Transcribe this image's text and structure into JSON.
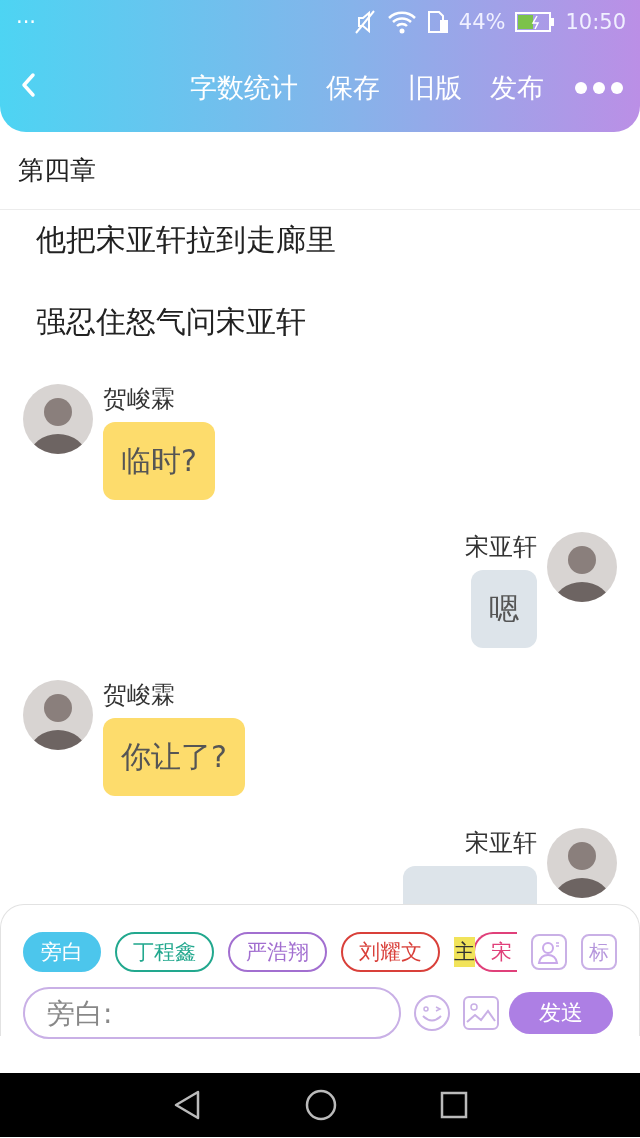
{
  "status_bar": {
    "notification": "···",
    "battery": "44%",
    "time": "10:50"
  },
  "header": {
    "actions": [
      "字数统计",
      "保存",
      "旧版",
      "发布"
    ]
  },
  "chapter_title": "第四章",
  "messages": [
    {
      "kind": "narration",
      "text": "他把宋亚轩拉到走廊里"
    },
    {
      "kind": "narration",
      "text": "强忍住怒气问宋亚轩"
    },
    {
      "kind": "chat",
      "mine": false,
      "speaker": "贺峻霖",
      "text": "临时?"
    },
    {
      "kind": "chat",
      "mine": true,
      "speaker": "宋亚轩",
      "text": "嗯"
    },
    {
      "kind": "chat",
      "mine": false,
      "speaker": "贺峻霖",
      "text": "你让了?"
    },
    {
      "kind": "chat",
      "mine": true,
      "speaker": "宋亚轩"
    }
  ],
  "composer": {
    "roles": [
      {
        "label": "旁白",
        "color": "#4cc6ec",
        "selected": true
      },
      {
        "label": "丁程鑫",
        "color": "#22a88e",
        "selected": false
      },
      {
        "label": "严浩翔",
        "color": "#a26fd0",
        "selected": false
      },
      {
        "label": "刘耀文",
        "color": "#d9403a",
        "selected": false
      },
      {
        "label": "宋",
        "color": "#e0407a",
        "selected": false,
        "badge": "主"
      }
    ],
    "tag_button": "标",
    "placeholder": "旁白:",
    "send": "发送"
  }
}
